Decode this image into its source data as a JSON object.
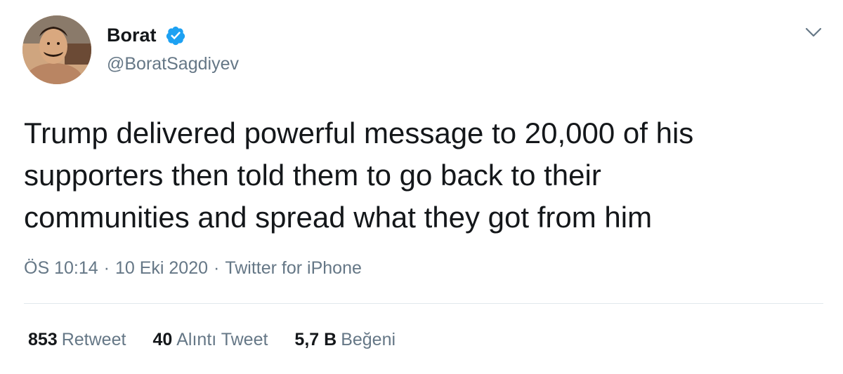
{
  "author": {
    "display_name": "Borat",
    "handle": "@BoratSagdiyev",
    "verified": true,
    "verified_icon": "verified-badge-icon",
    "avatar_icon": "profile-photo"
  },
  "menu": {
    "icon": "chevron-down-icon"
  },
  "tweet": {
    "lines": [
      "Trump delivered powerful message to 20,000 of his",
      "supporters then told them to go back to their",
      "communities and spread what they got from him"
    ]
  },
  "meta": {
    "time": "ÖS 10:14",
    "separator": "·",
    "date": "10 Eki 2020",
    "source": "Twitter for iPhone"
  },
  "stats": {
    "retweets": {
      "count": "853",
      "label": "Retweet"
    },
    "quotes": {
      "count": "40",
      "label": "Alıntı Tweet"
    },
    "likes": {
      "count": "5,7 B",
      "label": "Beğeni"
    }
  },
  "colors": {
    "text": "#14171a",
    "secondary": "#657786",
    "verified": "#1da1f2",
    "divider": "#e1e8ed"
  }
}
